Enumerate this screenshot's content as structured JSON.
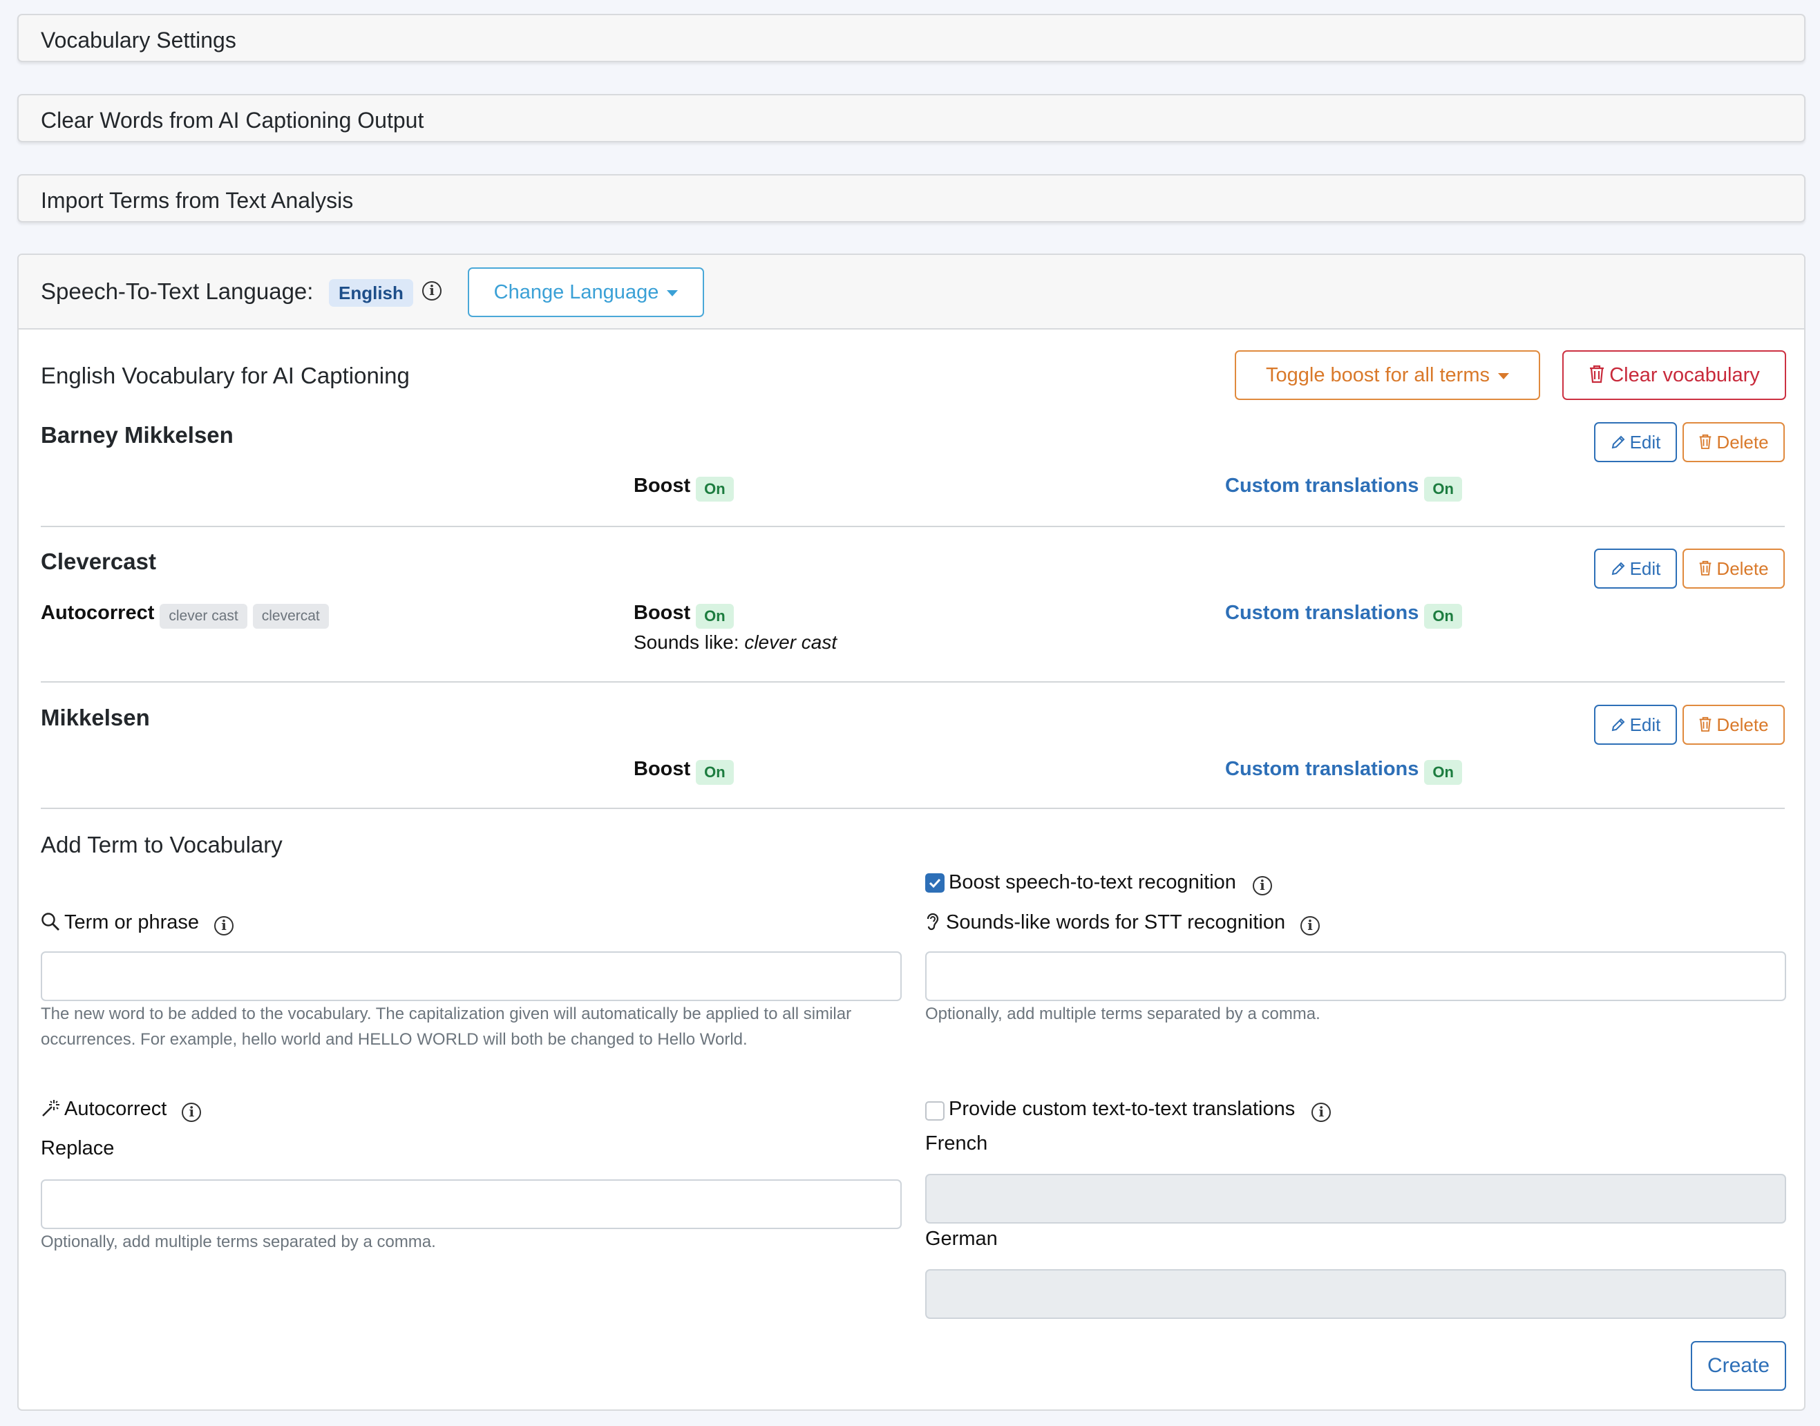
{
  "accordions": [
    {
      "title": "Vocabulary Settings"
    },
    {
      "title": "Clear Words from AI Captioning Output"
    },
    {
      "title": "Import Terms from Text Analysis"
    }
  ],
  "language_card": {
    "label": "Speech-To-Text Language:",
    "language": "English",
    "change_button": "Change Language"
  },
  "vocabulary": {
    "title": "English Vocabulary for AI Captioning",
    "toggle_boost_button": "Toggle boost for all terms",
    "clear_button": "Clear vocabulary",
    "edit_label": "Edit",
    "delete_label": "Delete",
    "boost_label": "Boost",
    "custom_translations_label": "Custom translations",
    "autocorrect_label": "Autocorrect",
    "sounds_like_prefix": "Sounds like:",
    "on_label": "On",
    "terms": [
      {
        "name": "Barney Mikkelsen",
        "boost": "On",
        "custom_translations": "On"
      },
      {
        "name": "Clevercast",
        "autocorrect": [
          "clever cast",
          "clevercat"
        ],
        "boost": "On",
        "sounds_like": "clever cast",
        "custom_translations": "On"
      },
      {
        "name": "Mikkelsen",
        "boost": "On",
        "custom_translations": "On"
      }
    ]
  },
  "add_term": {
    "title": "Add Term to Vocabulary",
    "term_label": "Term or phrase",
    "term_value": "",
    "term_help_line1": "The new word to be added to the vocabulary. The capitalization given will automatically be applied to all similar",
    "term_help_line2": "occurrences. For example, hello world and HELLO WORLD will both be changed to Hello World.",
    "boost_checkbox_label": "Boost speech-to-text recognition",
    "boost_checked": true,
    "sounds_like_label": "Sounds-like words for STT recognition",
    "sounds_like_value": "",
    "sounds_like_help": "Optionally, add multiple terms separated by a comma.",
    "autocorrect_label": "Autocorrect",
    "replace_label": "Replace",
    "replace_value": "",
    "replace_help": "Optionally, add multiple terms separated by a comma.",
    "translations_checkbox_label": "Provide custom text-to-text translations",
    "translations_checked": false,
    "french_label": "French",
    "german_label": "German",
    "create_button": "Create"
  },
  "colors": {
    "primary": "#2d6fb7",
    "info": "#3aa0d6",
    "warning": "#d9792a",
    "danger": "#c82a3b",
    "success_badge_bg": "#d8f3e1",
    "success_badge_text": "#1c7c3f"
  }
}
